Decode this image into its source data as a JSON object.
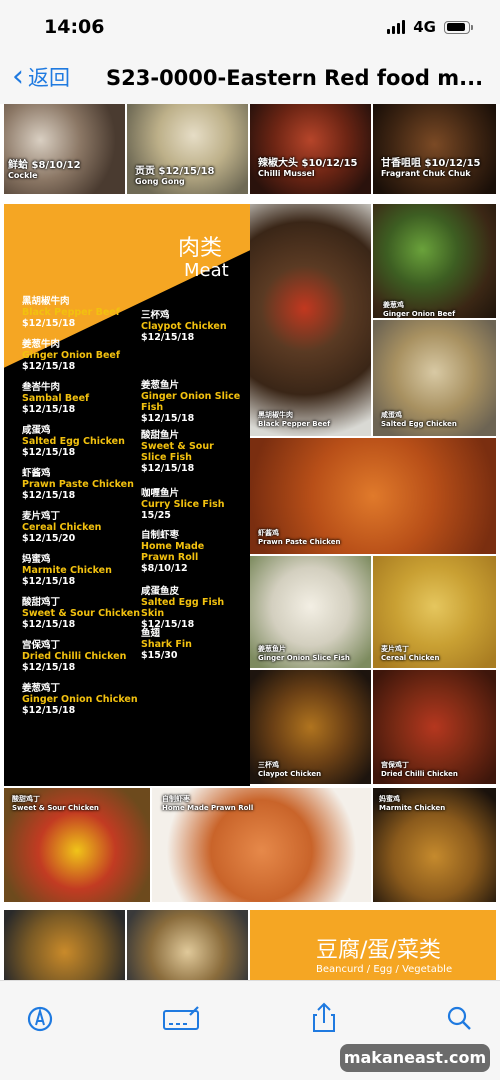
{
  "status": {
    "time": "14:06",
    "network": "4G"
  },
  "nav": {
    "back_label": "返回",
    "title": "S23-0000-Eastern Red food m..."
  },
  "top_row": [
    {
      "zh": "鲜蛤 $8/10/12",
      "en": "Cockle"
    },
    {
      "zh": "贡贡 $12/15/18",
      "en": "Gong Gong"
    },
    {
      "zh": "辣椒大头 $10/12/15",
      "en": "Chilli Mussel"
    },
    {
      "zh": "甘香咀咀 $10/12/15",
      "en": "Fragrant Chuk Chuk"
    }
  ],
  "meat": {
    "title_zh": "肉类",
    "title_en": "Meat",
    "left_items": [
      {
        "zh": "黑胡椒牛肉",
        "en": "Black Pepper Beef",
        "price": "$12/15/18"
      },
      {
        "zh": "姜葱牛肉",
        "en": "Ginger Onion Beef",
        "price": "$12/15/18"
      },
      {
        "zh": "叁峇牛肉",
        "en": "Sambal Beef",
        "price": "$12/15/18"
      },
      {
        "zh": "咸蛋鸡",
        "en": "Salted Egg Chicken",
        "price": "$12/15/18"
      },
      {
        "zh": "虾酱鸡",
        "en": "Prawn Paste Chicken",
        "price": "$12/15/18"
      },
      {
        "zh": "麦片鸡丁",
        "en": "Cereal Chicken",
        "price": "$12/15/20"
      },
      {
        "zh": "妈蜜鸡",
        "en": "Marmite Chicken",
        "price": "$12/15/18"
      },
      {
        "zh": "酸甜鸡丁",
        "en": "Sweet & Sour Chicken",
        "price": "$12/15/18"
      },
      {
        "zh": "宫保鸡丁",
        "en": "Dried Chilli Chicken",
        "price": "$12/15/18"
      },
      {
        "zh": "姜葱鸡丁",
        "en": "Ginger Onion Chicken",
        "price": "$12/15/18"
      }
    ],
    "right_items": [
      {
        "zh": "三杯鸡",
        "en": "Claypot Chicken",
        "price": "$12/15/18"
      },
      {
        "zh": "姜葱鱼片",
        "en": "Ginger Onion Slice Fish",
        "price": "$12/15/18"
      },
      {
        "zh": "酸甜鱼片",
        "en": "Sweet & Sour Slice Fish",
        "price": "$12/15/18"
      },
      {
        "zh": "咖喱鱼片",
        "en": "Curry Slice Fish",
        "price": "15/25"
      },
      {
        "zh": "自制虾枣",
        "en": "Home Made Prawn Roll",
        "price": "$8/10/12"
      },
      {
        "zh": "咸蛋鱼皮",
        "en": "Salted Egg Fish Skin",
        "price": "$12/15/18"
      },
      {
        "zh": "鱼翅",
        "en": "Shark Fin",
        "price": "$15/30"
      }
    ]
  },
  "photos": [
    {
      "zh": "姜葱鸡",
      "en": "Ginger Onion Beef"
    },
    {
      "zh": "黑胡椒牛肉",
      "en": "Black Pepper Beef"
    },
    {
      "zh": "咸蛋鸡",
      "en": "Salted Egg Chicken"
    },
    {
      "zh": "虾酱鸡",
      "en": "Prawn Paste Chicken"
    },
    {
      "zh": "姜葱鱼片",
      "en": "Ginger Onion Slice Fish"
    },
    {
      "zh": "麦片鸡丁",
      "en": "Cereal Chicken"
    },
    {
      "zh": "三杯鸡",
      "en": "Claypot Chicken"
    },
    {
      "zh": "宫保鸡丁",
      "en": "Dried Chilli Chicken"
    },
    {
      "zh": "酸甜鸡丁",
      "en": "Sweet & Sour Chicken"
    },
    {
      "zh": "自制虾枣",
      "en": "Home Made Prawn Roll"
    },
    {
      "zh": "妈蜜鸡",
      "en": "Marmite Chicken"
    }
  ],
  "next_section": {
    "title_zh": "豆腐/蛋/菜类",
    "title_en": "Beancurd / Egg / Vegetable"
  },
  "toolbar": {
    "markup": "markup-icon",
    "signature": "signature-icon",
    "share": "share-icon",
    "search": "search-icon"
  },
  "watermark": "makaneast.com",
  "colors": {
    "accent": "#1f7ae0",
    "menu_yellow": "#f5a623",
    "menu_black": "#000000",
    "item_en": "#f2c10f"
  }
}
